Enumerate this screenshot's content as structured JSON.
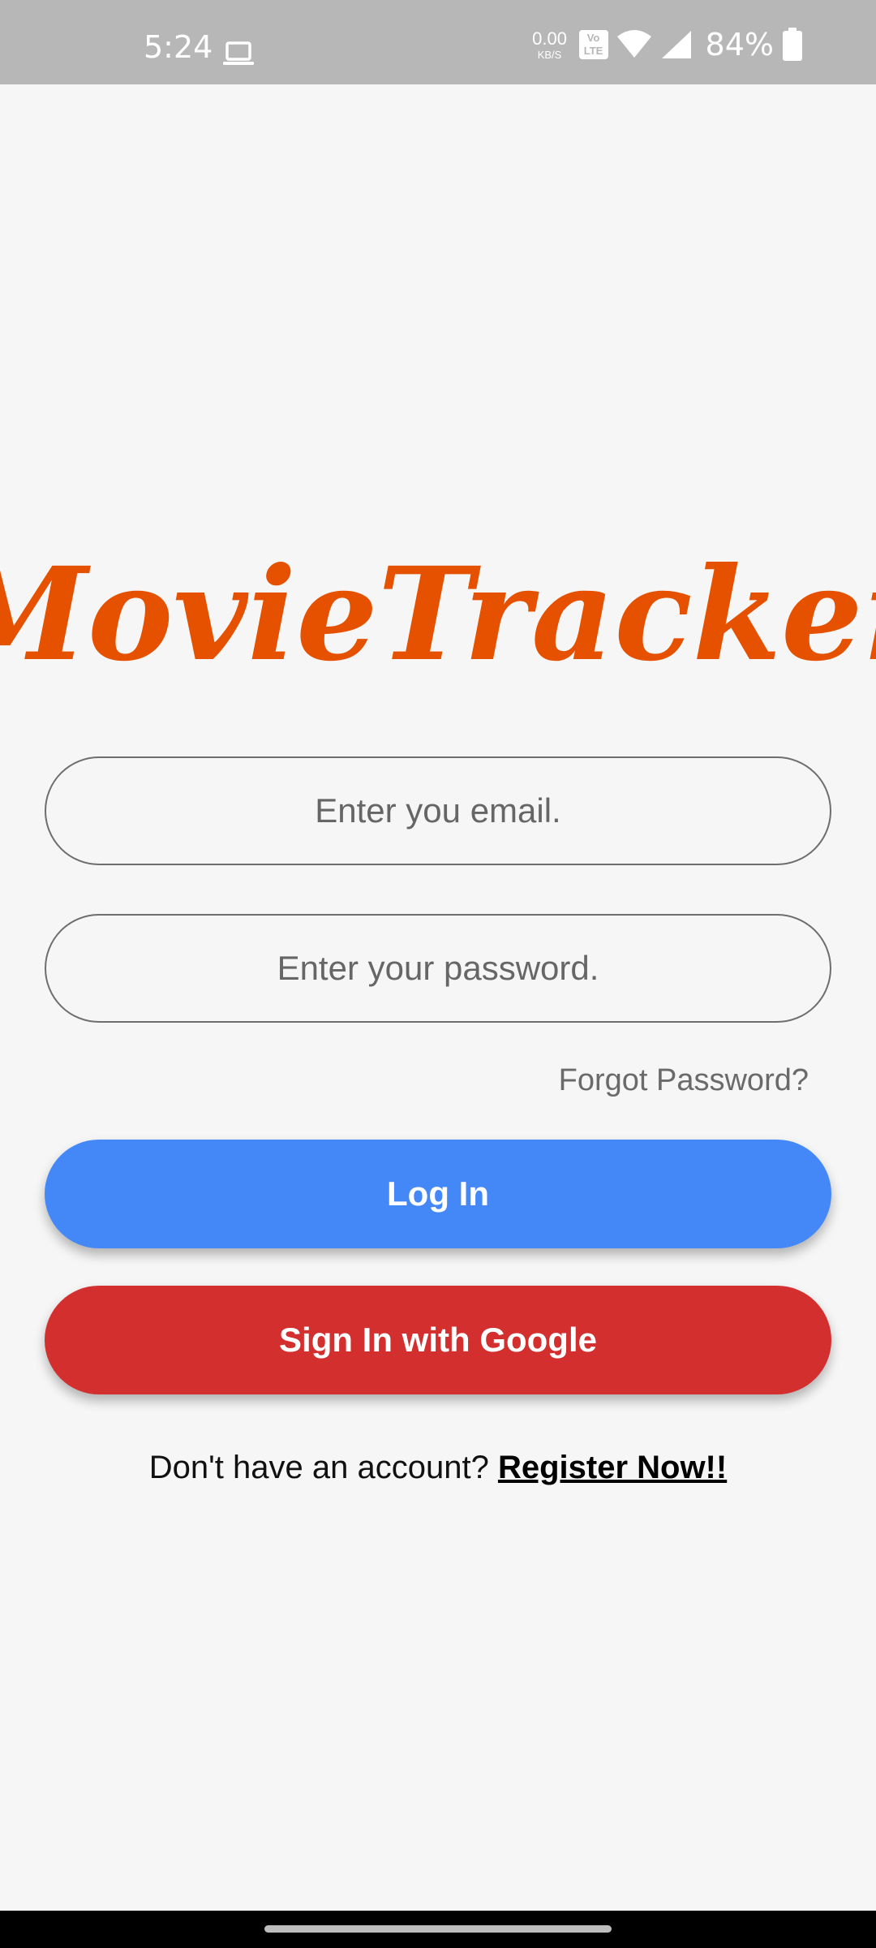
{
  "status_bar": {
    "time": "5:24",
    "net_speed_value": "0.00",
    "net_speed_unit": "KB/S",
    "volte_top": "Vo",
    "volte_bottom": "LTE",
    "battery": "84%",
    "icons": [
      "laptop-icon",
      "wifi-icon",
      "signal-icon",
      "battery-icon"
    ]
  },
  "logo": {
    "text": "MovieTracker",
    "color": "#e65100"
  },
  "form": {
    "email_placeholder": "Enter you email.",
    "password_placeholder": "Enter your password.",
    "forgot_label": "Forgot Password?",
    "login_label": "Log In",
    "google_label": "Sign In with Google",
    "register_prompt": "Don't have an account?",
    "register_link": "Register Now!!"
  },
  "colors": {
    "login": "#4488f8",
    "google": "#d32f2f",
    "background": "#f6f6f6",
    "status_bar": "#b7b7b7"
  }
}
